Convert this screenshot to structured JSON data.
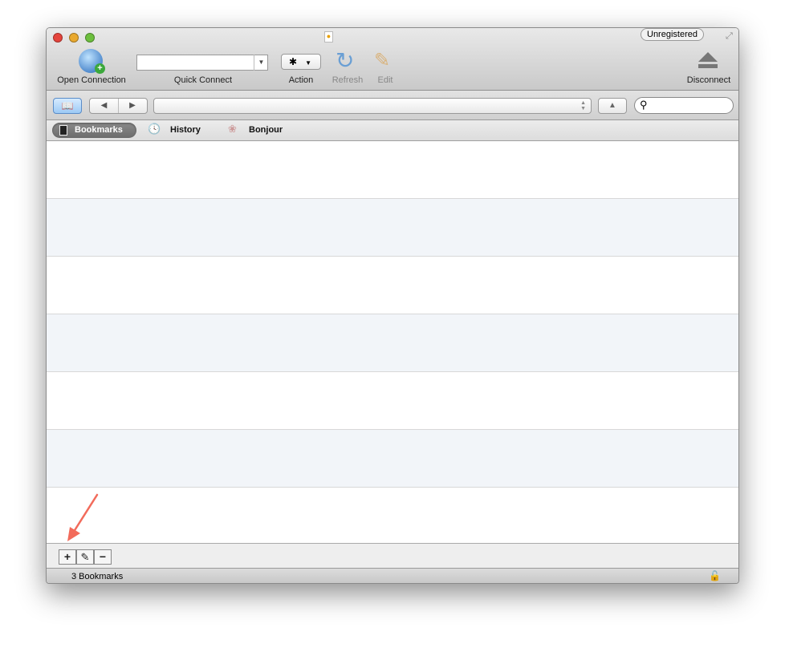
{
  "toolbar": {
    "open_connection": "Open Connection",
    "quick_connect": "Quick Connect",
    "quick_connect_value": "",
    "action": "Action",
    "refresh": "Refresh",
    "edit": "Edit",
    "disconnect": "Disconnect",
    "unregistered": "Unregistered"
  },
  "nav": {
    "path_value": "",
    "search_value": ""
  },
  "tabs": [
    {
      "label": "Bookmarks",
      "active": true
    },
    {
      "label": "History"
    },
    {
      "label": "Bonjour"
    }
  ],
  "bookmarks_rows": 3,
  "bottom": {
    "add": "+",
    "remove": "−"
  },
  "status": {
    "text": "3 Bookmarks"
  },
  "colors": {
    "row_alt": "#f2f5f9",
    "annotation_arrow": "#f26b5b"
  }
}
